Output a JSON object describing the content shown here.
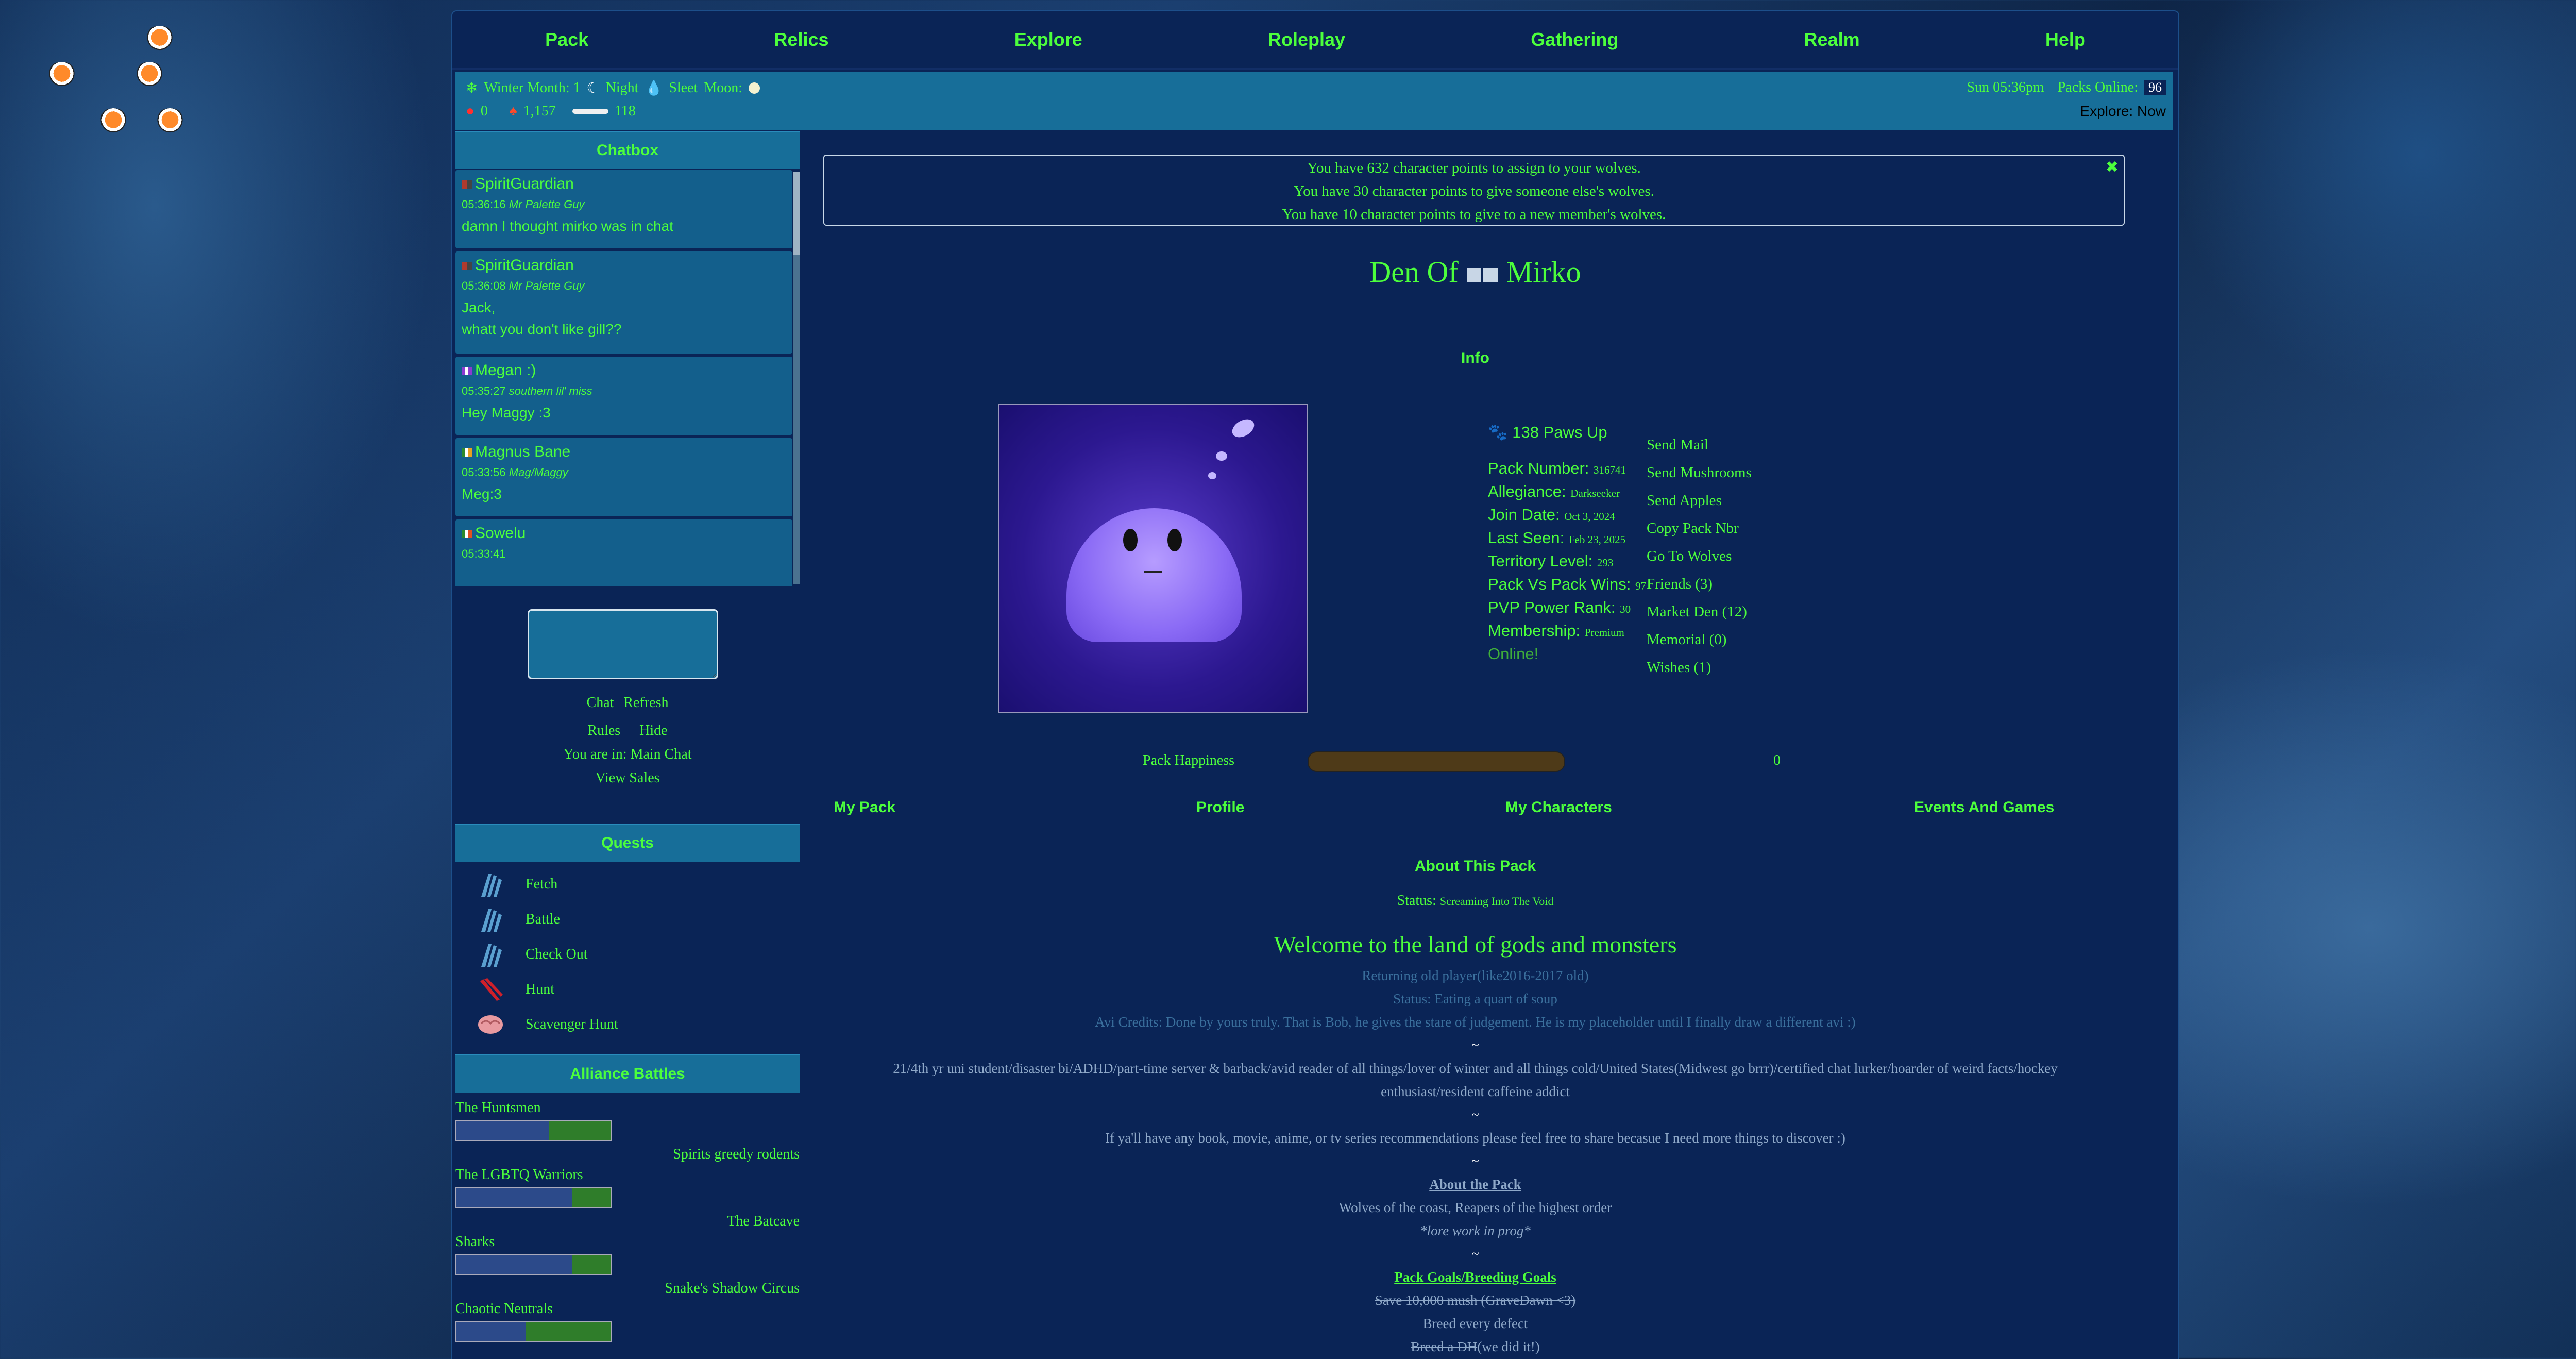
{
  "topnav": [
    "Pack",
    "Relics",
    "Explore",
    "Roleplay",
    "Gathering",
    "Realm",
    "Help"
  ],
  "status": {
    "winter_month": "Winter Month: 1",
    "night": "Night",
    "sleet": "Sleet",
    "moon": "Moon:",
    "apples": "0",
    "mushrooms": "1,157",
    "bones": "118",
    "time": "Sun 05:36pm",
    "packs_online_label": "Packs Online:",
    "packs_online": "96",
    "explore": "Explore: Now"
  },
  "chatbox": {
    "title": "Chatbox",
    "messages": [
      {
        "name": "SpiritGuardian",
        "time": "05:36:16",
        "sub": "Mr Palette Guy",
        "text": "damn I thought mirko was in chat"
      },
      {
        "name": "SpiritGuardian",
        "time": "05:36:08",
        "sub": "Mr Palette Guy",
        "text": "Jack,\nwhatt you don't like gill??"
      },
      {
        "name": "Megan :)",
        "time": "05:35:27",
        "sub": "southern lil' miss",
        "text": "Hey Maggy :3"
      },
      {
        "name": "Magnus Bane",
        "time": "05:33:56",
        "sub": "Mag/Maggy",
        "text": "Meg:3"
      },
      {
        "name": "Sowelu",
        "time": "05:33:41",
        "sub": "",
        "text": ""
      }
    ],
    "chat": "Chat",
    "refresh": "Refresh",
    "rules": "Rules",
    "hide": "Hide",
    "location": "You are in: Main Chat",
    "view_sales": "View Sales"
  },
  "quests": {
    "title": "Quests",
    "items": [
      "Fetch",
      "Battle",
      "Check Out",
      "Hunt",
      "Scavenger Hunt"
    ]
  },
  "alliance": {
    "title": "Alliance Battles",
    "teams": [
      {
        "name": "The Huntsmen",
        "side": "left",
        "progress": 0.4
      },
      {
        "name": "Spirits greedy rodents",
        "side": "right"
      },
      {
        "name": "The LGBTQ Warriors",
        "side": "left",
        "progress": 0.25
      },
      {
        "name": "The Batcave",
        "side": "right"
      },
      {
        "name": "Sharks",
        "side": "left",
        "progress": 0.25
      },
      {
        "name": "Snake's Shadow Circus",
        "side": "right"
      },
      {
        "name": "Chaotic Neutrals",
        "side": "left",
        "progress": 0.55
      }
    ]
  },
  "notice": [
    "You have 632 character points to assign to your wolves.",
    "You have 30 character points to give someone else's wolves.",
    "You have 10 character points to give to a new member's wolves."
  ],
  "den": {
    "prefix": "Den Of",
    "name": "Mirko"
  },
  "info": {
    "title": "Info",
    "paws": "138 Paws Up",
    "stats": [
      {
        "label": "Pack Number:",
        "value": "316741"
      },
      {
        "label": "Allegiance:",
        "value": "Darkseeker"
      },
      {
        "label": "Join Date:",
        "value": "Oct 3, 2024"
      },
      {
        "label": "Last Seen:",
        "value": "Feb 23, 2025"
      },
      {
        "label": "Territory Level:",
        "value": "293"
      },
      {
        "label": "Pack Vs Pack Wins:",
        "value": "97"
      },
      {
        "label": "PVP Power Rank:",
        "value": "30"
      },
      {
        "label": "Membership:",
        "value": "Premium"
      }
    ],
    "online": "Online!",
    "actions": [
      "Send Mail",
      "Send Mushrooms",
      "Send Apples",
      "Copy Pack Nbr",
      "Go To Wolves",
      "Friends (3)",
      "Market Den (12)",
      "Memorial (0)",
      "Wishes (1)"
    ]
  },
  "happiness": {
    "label": "Pack Happiness",
    "value": "0"
  },
  "subnav": [
    "My Pack",
    "Profile",
    "My Characters",
    "Events And Games"
  ],
  "about": {
    "title": "About This Pack",
    "status_label": "Status:",
    "status_value": "Screaming Into The Void",
    "welcome": "Welcome to the land of gods and monsters",
    "line1": "Returning old player(like2016-2017 old)",
    "line2": "Status: Eating a quart of soup",
    "line3": "Avi Credits: Done by yours truly. That is Bob, he gives the stare of judgement. He is my placeholder until I finally draw a different avi :)",
    "tilde": "~",
    "bio": "21/4th yr uni student/disaster bi/ADHD/part-time server & barback/avid reader of all things/lover of winter and all things cold/United States(Midwest go brrr)/certified chat lurker/hoarder of weird facts/hockey enthusiast/resident caffeine addict",
    "recs": "If ya'll have any book, movie, anime, or tv series recommendations please feel free to share becasue I need more things to discover :)",
    "about_pack": "About the Pack",
    "wolves": "Wolves of the coast, Reapers of the highest order",
    "lore": "*lore work in prog*",
    "goals": "Pack Goals/Breeding Goals",
    "goal1": "Save 10,000 mush (GraveDawn <3)",
    "goal2": "Breed every defect",
    "goal3": "Breed a DH",
    "goal3b": "(we did it!)"
  }
}
